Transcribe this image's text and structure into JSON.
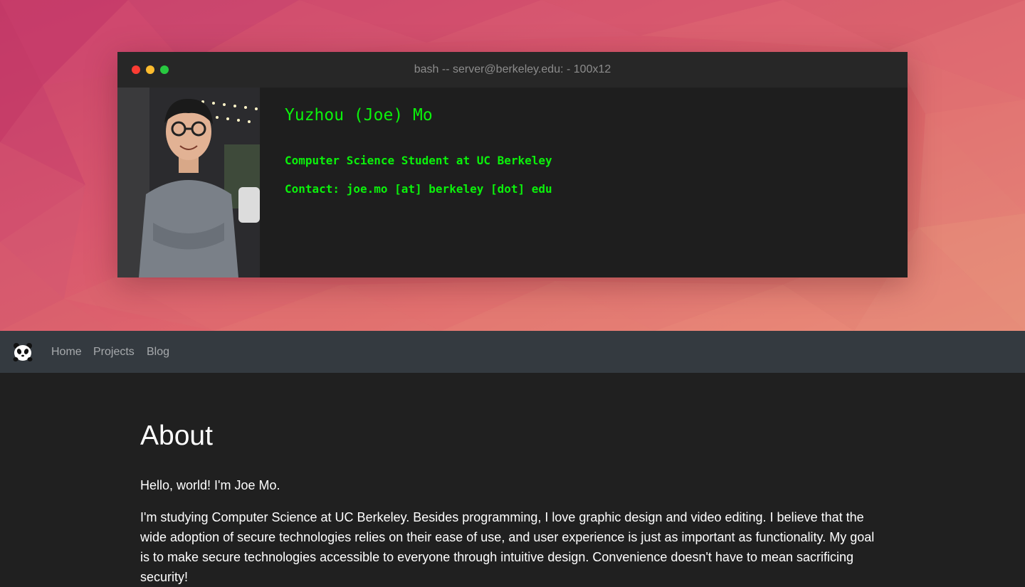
{
  "terminal": {
    "title": "bash -- server@berkeley.edu: - 100x12",
    "name": "Yuzhou (Joe) Mo",
    "line1": "Computer Science Student at UC Berkeley",
    "line2": "Contact: joe.mo [at] berkeley [dot] edu"
  },
  "nav": {
    "home": "Home",
    "projects": "Projects",
    "blog": "Blog"
  },
  "about": {
    "heading": "About",
    "hello": "Hello, world! I'm Joe Mo.",
    "paragraph": "I'm studying Computer Science at UC Berkeley. Besides programming, I love graphic design and video editing. I believe that the wide adoption of secure technologies relies on their ease of use, and user experience is just as important as functionality. My goal is to make secure technologies accessible to everyone through intuitive design. Convenience doesn't have to mean sacrificing security!"
  },
  "colors": {
    "terminal_text": "#0bf10b",
    "navbar_bg": "#343a40",
    "page_bg": "#202020",
    "hero_pink": "#d8566e"
  }
}
